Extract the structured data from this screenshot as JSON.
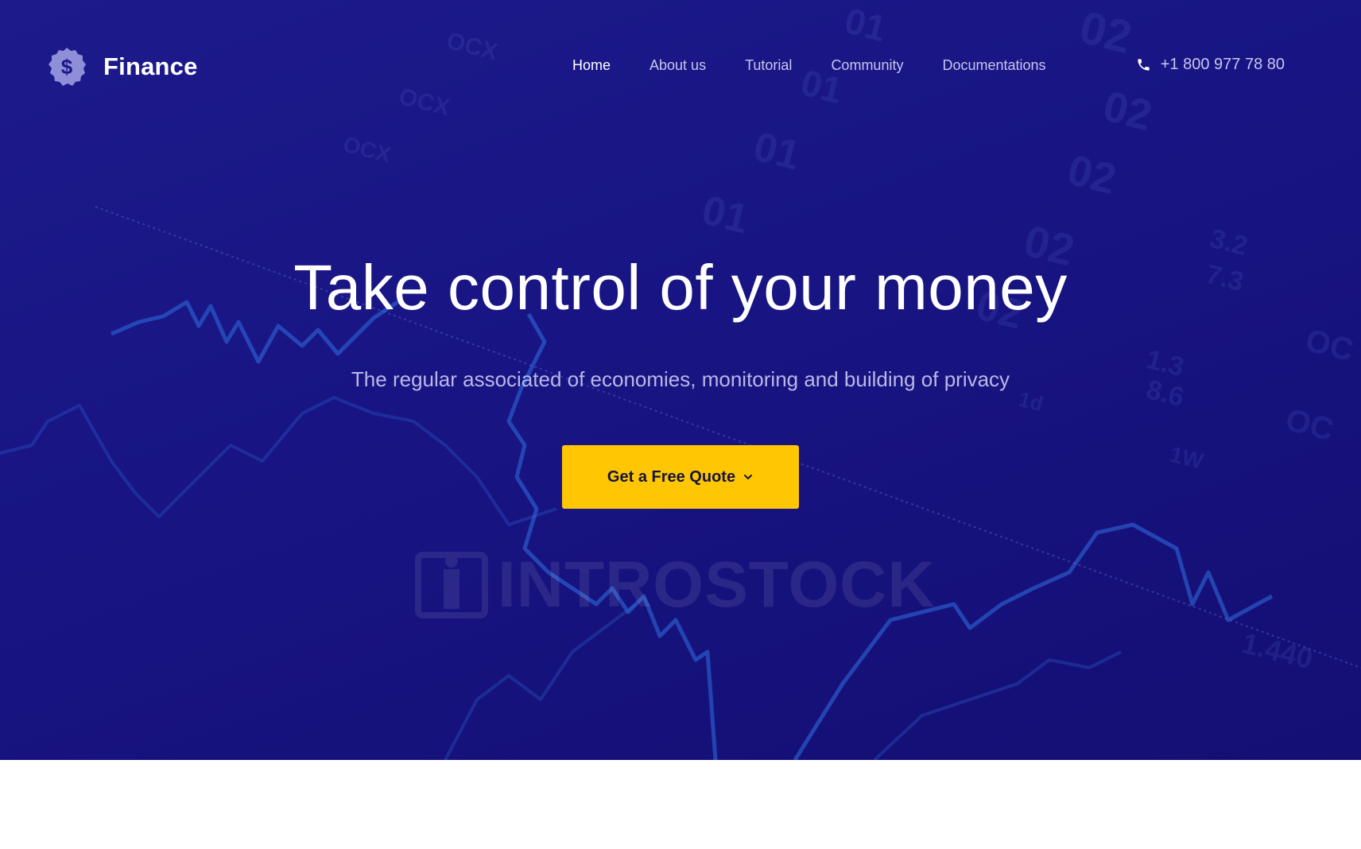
{
  "brand": {
    "name": "Finance",
    "icon": "dollar-badge-icon"
  },
  "nav": {
    "items": [
      {
        "label": "Home",
        "active": true
      },
      {
        "label": "About us",
        "active": false
      },
      {
        "label": "Tutorial",
        "active": false
      },
      {
        "label": "Community",
        "active": false
      },
      {
        "label": "Documentations",
        "active": false
      }
    ]
  },
  "phone": {
    "icon": "phone-icon",
    "number": "+1 800 977 78 80"
  },
  "hero": {
    "title": "Take control of your money",
    "subtitle": "The regular associated of economies, monitoring and building of privacy",
    "cta_label": "Get a Free Quote",
    "cta_icon": "chevron-down-icon",
    "watermark": "INTROSTOCK"
  },
  "colors": {
    "hero_background": "#18148a",
    "accent": "#fec603",
    "chart_line": "#2f6fe0",
    "nav_text": "#c7c6ec",
    "page_background": "#ffffff"
  }
}
